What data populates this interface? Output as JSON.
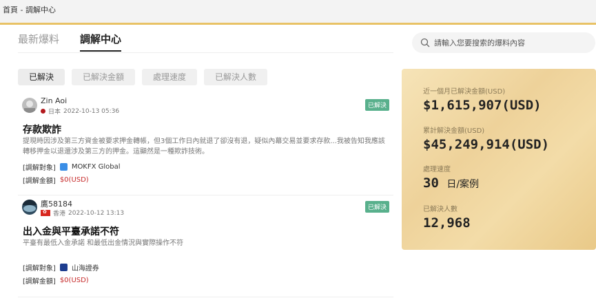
{
  "breadcrumb": "首頁 - 調解中心",
  "tabs": [
    {
      "label": "最新爆料",
      "active": false
    },
    {
      "label": "調解中心",
      "active": true
    }
  ],
  "search": {
    "placeholder": "請輸入您要搜索的爆料內容",
    "icon": "search-icon"
  },
  "filters": [
    {
      "label": "已解決",
      "active": true
    },
    {
      "label": "已解決金額",
      "active": false
    },
    {
      "label": "處理速度",
      "active": false
    },
    {
      "label": "已解決人數",
      "active": false
    }
  ],
  "complaints": [
    {
      "user": "Zin Aoi",
      "location": "日本",
      "time": "2022-10-13 05:36",
      "status": "已解決",
      "title": "存款欺詐",
      "description": "提現時因涉及第三方資金被要求押金轉帳，但3個工作日內就退了卻沒有退，疑似內幕交易並要求存款...我被告知我應該轉移押金以退還涉及第三方的押金。這顯然是一種欺詐技術。",
      "target_label": "[調解對象]",
      "target": "MOKFX Global",
      "amount_label": "[調解金額]",
      "amount": "$0(USD)",
      "broker_color": "#3a8ee6"
    },
    {
      "user": "鷹58184",
      "location": "香港",
      "time": "2022-10-12 13:13",
      "status": "已解決",
      "title": "出入金與平臺承諾不符",
      "description": "平臺有最低入金承諾 和最低出金情況與實際操作不符",
      "target_label": "[調解對象]",
      "target": "山海證券",
      "amount_label": "[調解金額]",
      "amount": "$0(USD)",
      "broker_color": "#1d3d8f"
    }
  ],
  "stats": [
    {
      "label": "近一個月已解決金額(USD)",
      "value": "$1,615,907(USD)",
      "unit": ""
    },
    {
      "label": "累計解決金額(USD)",
      "value": "$45,249,914(USD)",
      "unit": ""
    },
    {
      "label": "處理速度",
      "value": "30",
      "unit": "日/案例"
    },
    {
      "label": "已解決人數",
      "value": "12,968",
      "unit": ""
    }
  ],
  "colors": {
    "accent": "#e8c265",
    "resolved_badge": "#58b08c",
    "amount_red": "#c62a2a"
  }
}
